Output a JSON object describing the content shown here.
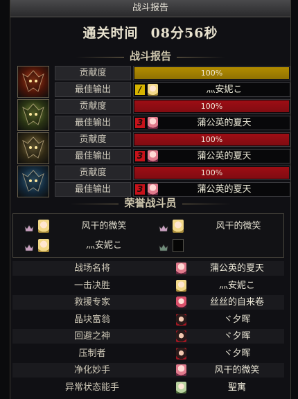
{
  "window": {
    "title": "战斗报告"
  },
  "clear_time": {
    "label": "通关时间",
    "value": "08分56秒"
  },
  "report": {
    "heading": "战斗报告",
    "bosses": [
      {
        "icon": "red-demon-boss-icon",
        "c1": "#b3421c",
        "c2": "#4a1408",
        "contrib_label": "贡献度",
        "contrib_value": "100%",
        "contrib_fraction": 1.0,
        "bar_color": "#b28c00",
        "best_label": "最佳输出",
        "rank": "/",
        "rank_style": "yellow",
        "avatar": "blond",
        "player": "灬安妮こ"
      },
      {
        "icon": "green-demon-boss-icon",
        "c1": "#7a8b3a",
        "c2": "#2a3414",
        "contrib_label": "贡献度",
        "contrib_value": "100%",
        "contrib_fraction": 1.0,
        "bar_color": "#9e0d14",
        "best_label": "最佳输出",
        "rank": "3",
        "rank_style": "red",
        "avatar": "pink",
        "player": "蒲公英的夏天"
      },
      {
        "icon": "gold-demon-boss-icon",
        "c1": "#8a7a48",
        "c2": "#2f2814",
        "contrib_label": "贡献度",
        "contrib_value": "100%",
        "contrib_fraction": 1.0,
        "bar_color": "#9e0d14",
        "best_label": "最佳输出",
        "rank": "3",
        "rank_style": "red",
        "avatar": "pink",
        "player": "蒲公英的夏天"
      },
      {
        "icon": "blue-demon-boss-icon",
        "c1": "#3f6f8a",
        "c2": "#12283a",
        "contrib_label": "贡献度",
        "contrib_value": "100%",
        "contrib_fraction": 1.0,
        "bar_color": "#9e0d14",
        "best_label": "最佳输出",
        "rank": "3",
        "rank_style": "red",
        "avatar": "pink",
        "player": "蒲公英的夏天"
      }
    ]
  },
  "honor": {
    "heading": "荣誉战斗员",
    "members": [
      {
        "avatar": "blond",
        "name": "风干的微笑",
        "empty": false
      },
      {
        "avatar": "blond",
        "name": "风干的微笑",
        "empty": false
      },
      {
        "avatar": "blond",
        "name": "灬安妮こ",
        "empty": false
      },
      {
        "avatar": "",
        "name": "",
        "empty": true
      }
    ]
  },
  "awards": [
    {
      "title": "战场名将",
      "avatar": "pink",
      "player": "蒲公英的夏天"
    },
    {
      "title": "一击决胜",
      "avatar": "blond",
      "player": "灬安妮こ"
    },
    {
      "title": "救援专家",
      "avatar": "mixed",
      "player": "丝丝的自来卷"
    },
    {
      "title": "晶块富翁",
      "avatar": "dark",
      "player": "ヾ夕晖"
    },
    {
      "title": "回避之神",
      "avatar": "dark",
      "player": "ヾ夕晖"
    },
    {
      "title": "压制者",
      "avatar": "dark",
      "player": "ヾ夕晖"
    },
    {
      "title": "净化妙手",
      "avatar": "pink",
      "player": "风干的微笑"
    },
    {
      "title": "异常状态能手",
      "avatar": "green",
      "player": "聖寓"
    }
  ]
}
